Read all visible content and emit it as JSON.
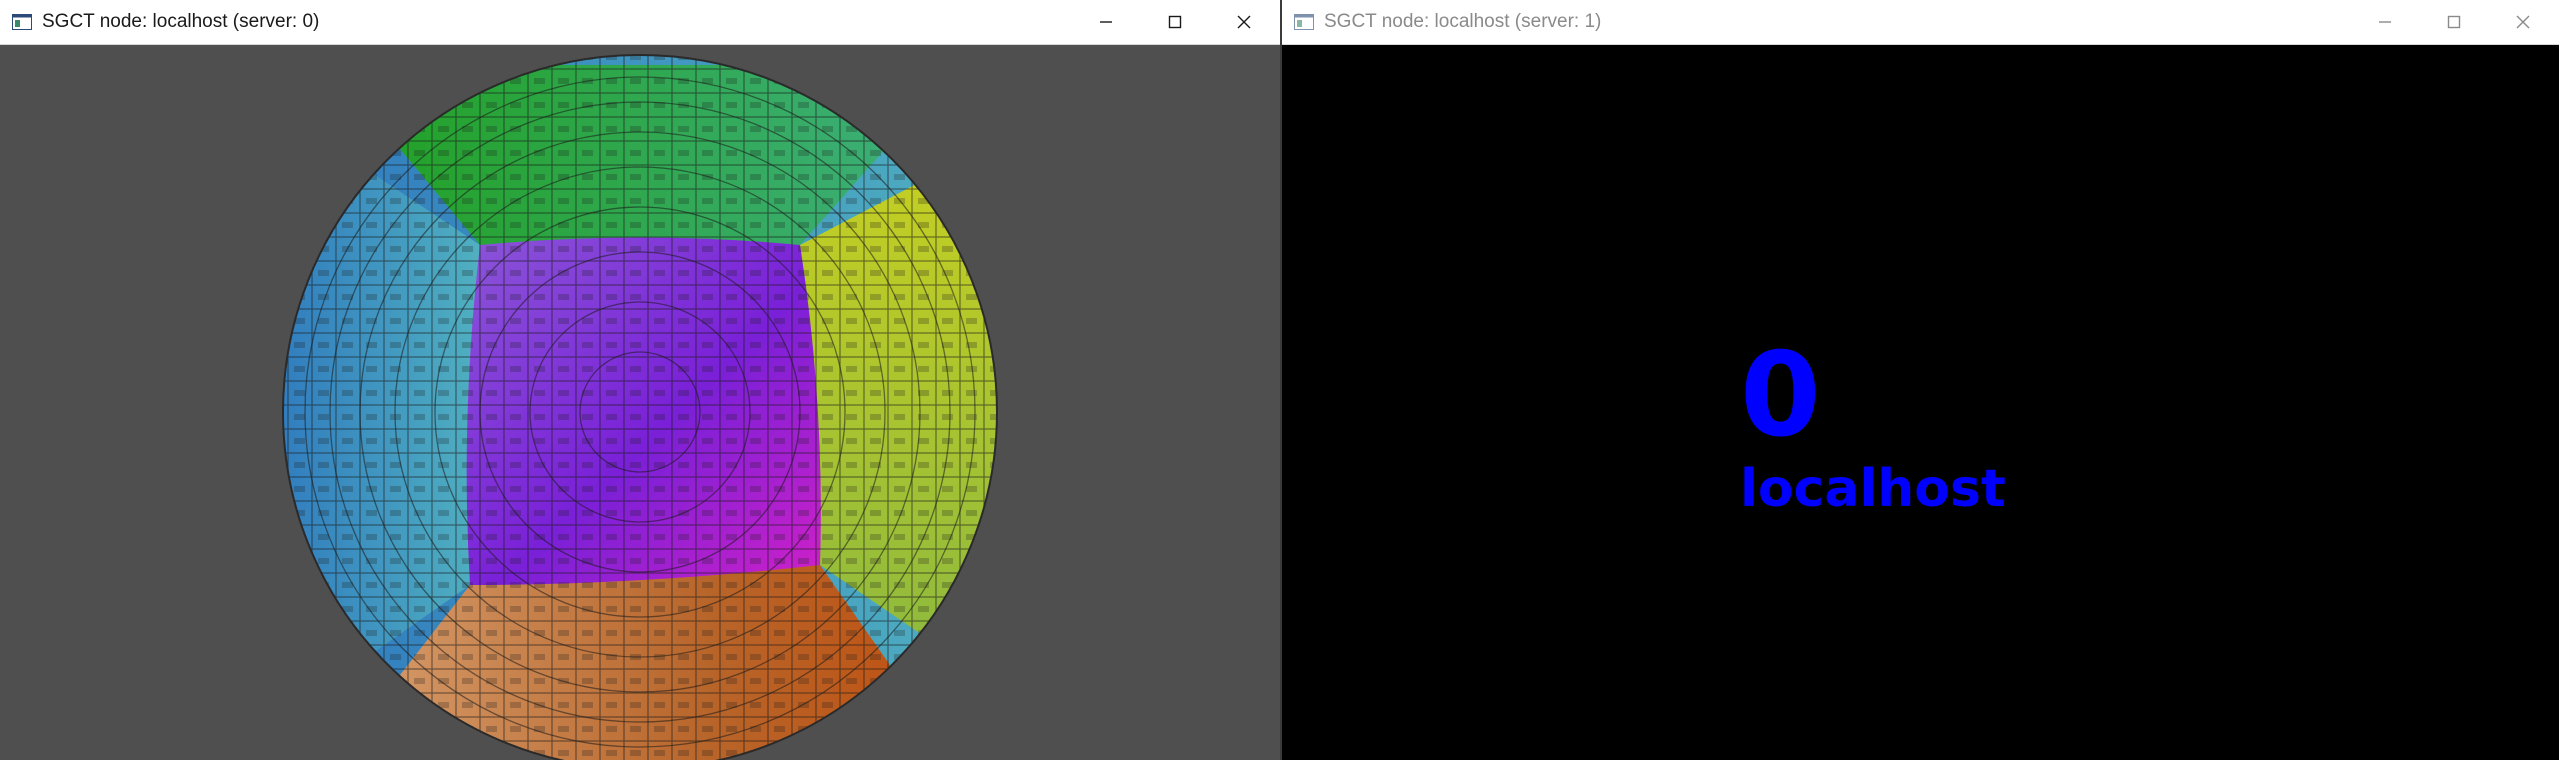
{
  "windows": [
    {
      "title": "SGCT node: localhost (server: 0)",
      "active": true,
      "controls": {
        "minimize_icon": "minimize-icon",
        "maximize_icon": "maximize-icon",
        "close_icon": "close-icon"
      }
    },
    {
      "title": "SGCT node: localhost (server: 1)",
      "active": false,
      "number": "0",
      "host": "localhost",
      "controls": {
        "minimize_icon": "minimize-icon",
        "maximize_icon": "maximize-icon",
        "close_icon": "close-icon"
      }
    }
  ],
  "colors": {
    "viewport_bg": "#4f4f4f",
    "label_blue": "#0000ff",
    "fisheye_face_top": "#2f9e3c",
    "fisheye_face_right": "#a8c020",
    "fisheye_face_bottom": "#b86a33",
    "fisheye_face_left": "#2f80c0",
    "fisheye_face_center": "#6a2fd0"
  }
}
